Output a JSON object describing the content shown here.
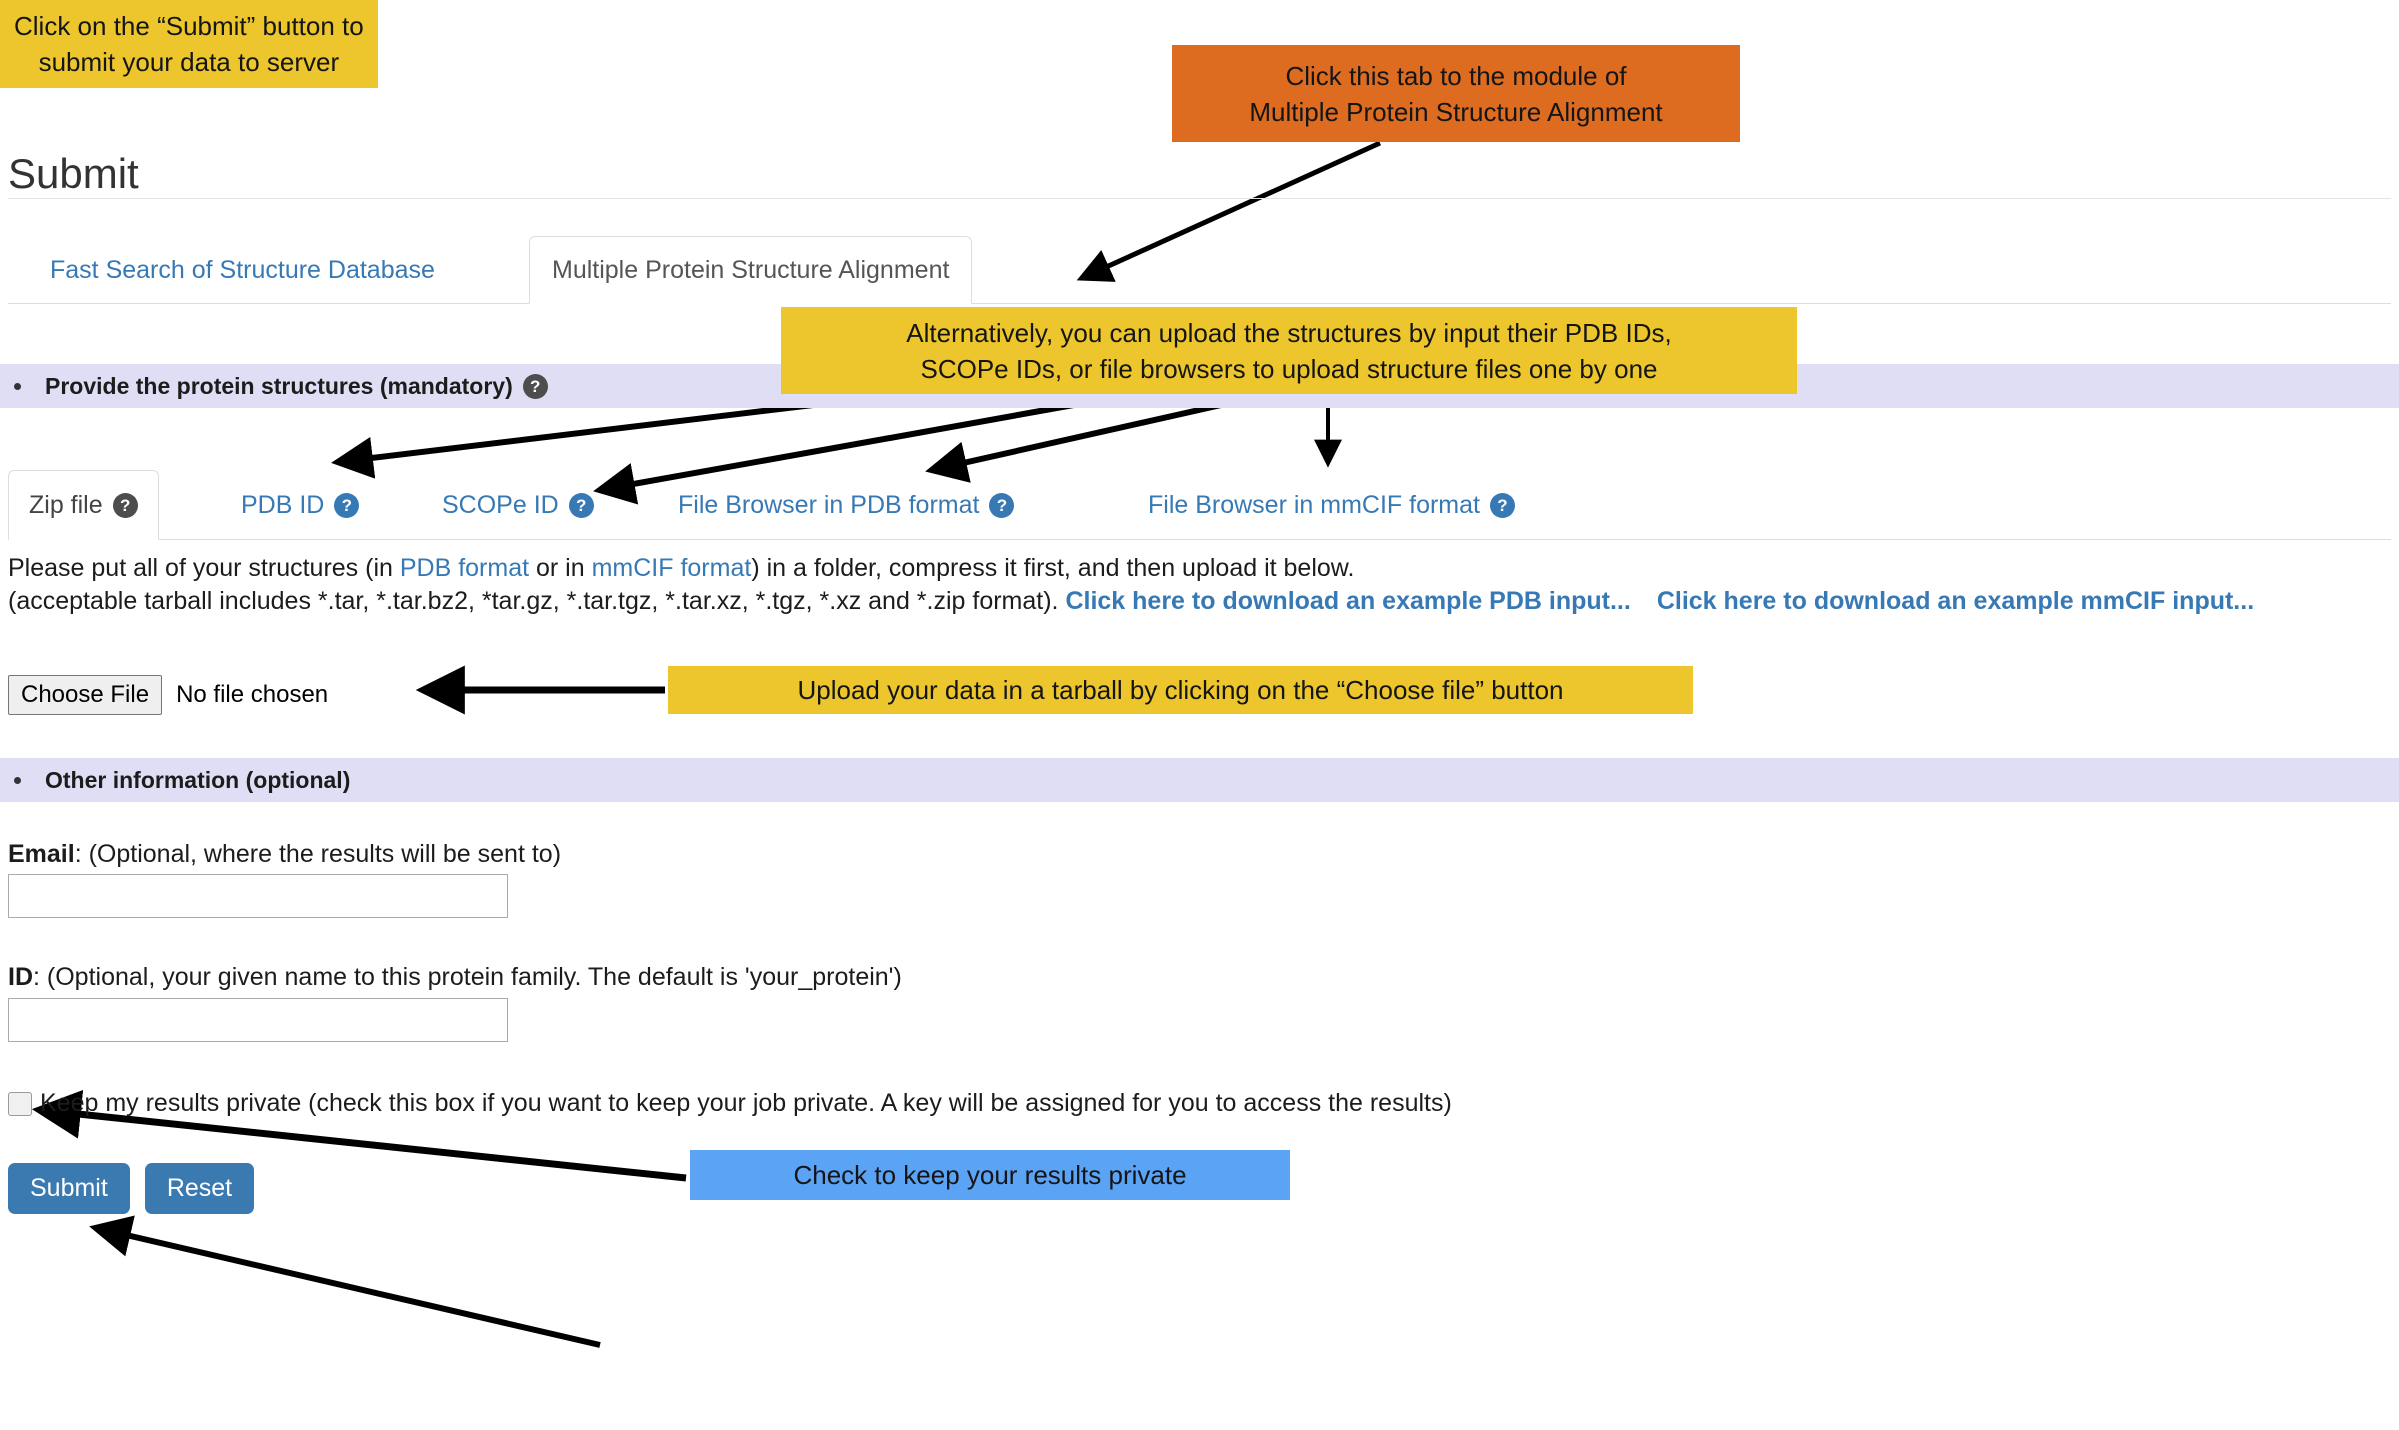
{
  "page": {
    "title": "Submit"
  },
  "main_tabs": [
    {
      "label": "Fast Search of Structure Database",
      "active": false
    },
    {
      "label": "Multiple Protein Structure Alignment",
      "active": true
    }
  ],
  "sections": {
    "structures": {
      "label": "Provide the protein structures (mandatory)",
      "help_icon": "help-circle-icon"
    },
    "other": {
      "label": "Other information (optional)"
    }
  },
  "inner_tabs": [
    {
      "label": "Zip file",
      "active": true,
      "help_icon": "help-circle-icon"
    },
    {
      "label": "PDB ID",
      "active": false,
      "help_icon": "help-circle-icon"
    },
    {
      "label": "SCOPe ID",
      "active": false,
      "help_icon": "help-circle-icon"
    },
    {
      "label": "File Browser in PDB format",
      "active": false,
      "help_icon": "help-circle-icon"
    },
    {
      "label": "File Browser in mmCIF format",
      "active": false,
      "help_icon": "help-circle-icon"
    }
  ],
  "instructions": {
    "line1_a": "Please put all of your structures (in ",
    "link_pdb": "PDB format",
    "line1_b": " or in ",
    "link_mmcif": "mmCIF format",
    "line1_c": ") in a folder, compress it first, and then upload it below.",
    "line2_a": "(acceptable tarball includes *.tar, *.tar.bz2, *tar.gz, *.tar.tgz, *.tar.xz, *.tgz, *.xz and *.zip format). ",
    "link_example_pdb": "Click here to download an example PDB input...",
    "link_example_mmcif": "Click here to download an example mmCIF input..."
  },
  "file_upload": {
    "button_label": "Choose File",
    "status": "No file chosen"
  },
  "fields": {
    "email": {
      "label_bold": "Email",
      "label_rest": ": (Optional, where the results will be sent to)",
      "value": "",
      "placeholder": ""
    },
    "id": {
      "label_bold": "ID",
      "label_rest": ": (Optional, your given name to this protein family. The default is 'your_protein')",
      "value": "",
      "placeholder": ""
    }
  },
  "privacy": {
    "label": "Keep my results private (check this box if you want to keep your job private. A key will be assigned for you to access the results)",
    "checked": false
  },
  "actions": {
    "submit_label": "Submit",
    "reset_label": "Reset"
  },
  "callouts": {
    "tab": {
      "line1": "Click this tab to the module of",
      "line2": "Multiple Protein Structure Alignment",
      "color": "#dd6b20"
    },
    "upload": {
      "line1": "Alternatively, you can upload the structures by input their PDB IDs,",
      "line2": "SCOPe IDs, or file browsers to upload structure files one by one",
      "color": "#ecc62c"
    },
    "tarball": {
      "line1": "Upload your data in a tarball by clicking on the “Choose file” button",
      "color": "#ecc62c"
    },
    "private": {
      "line1": "Check to keep your results private",
      "color": "#5ba3f5"
    },
    "submit": {
      "line1": "Click on the “Submit” button to",
      "line2": "submit your data to server",
      "color": "#ecc62c"
    }
  },
  "colors": {
    "link_blue": "#3779b4",
    "section_bar": "#dfdef4",
    "button_blue": "#3a7ab0",
    "callout_orange": "#dd6b20",
    "callout_yellow": "#ecc62c",
    "callout_blue": "#5ba3f5"
  }
}
